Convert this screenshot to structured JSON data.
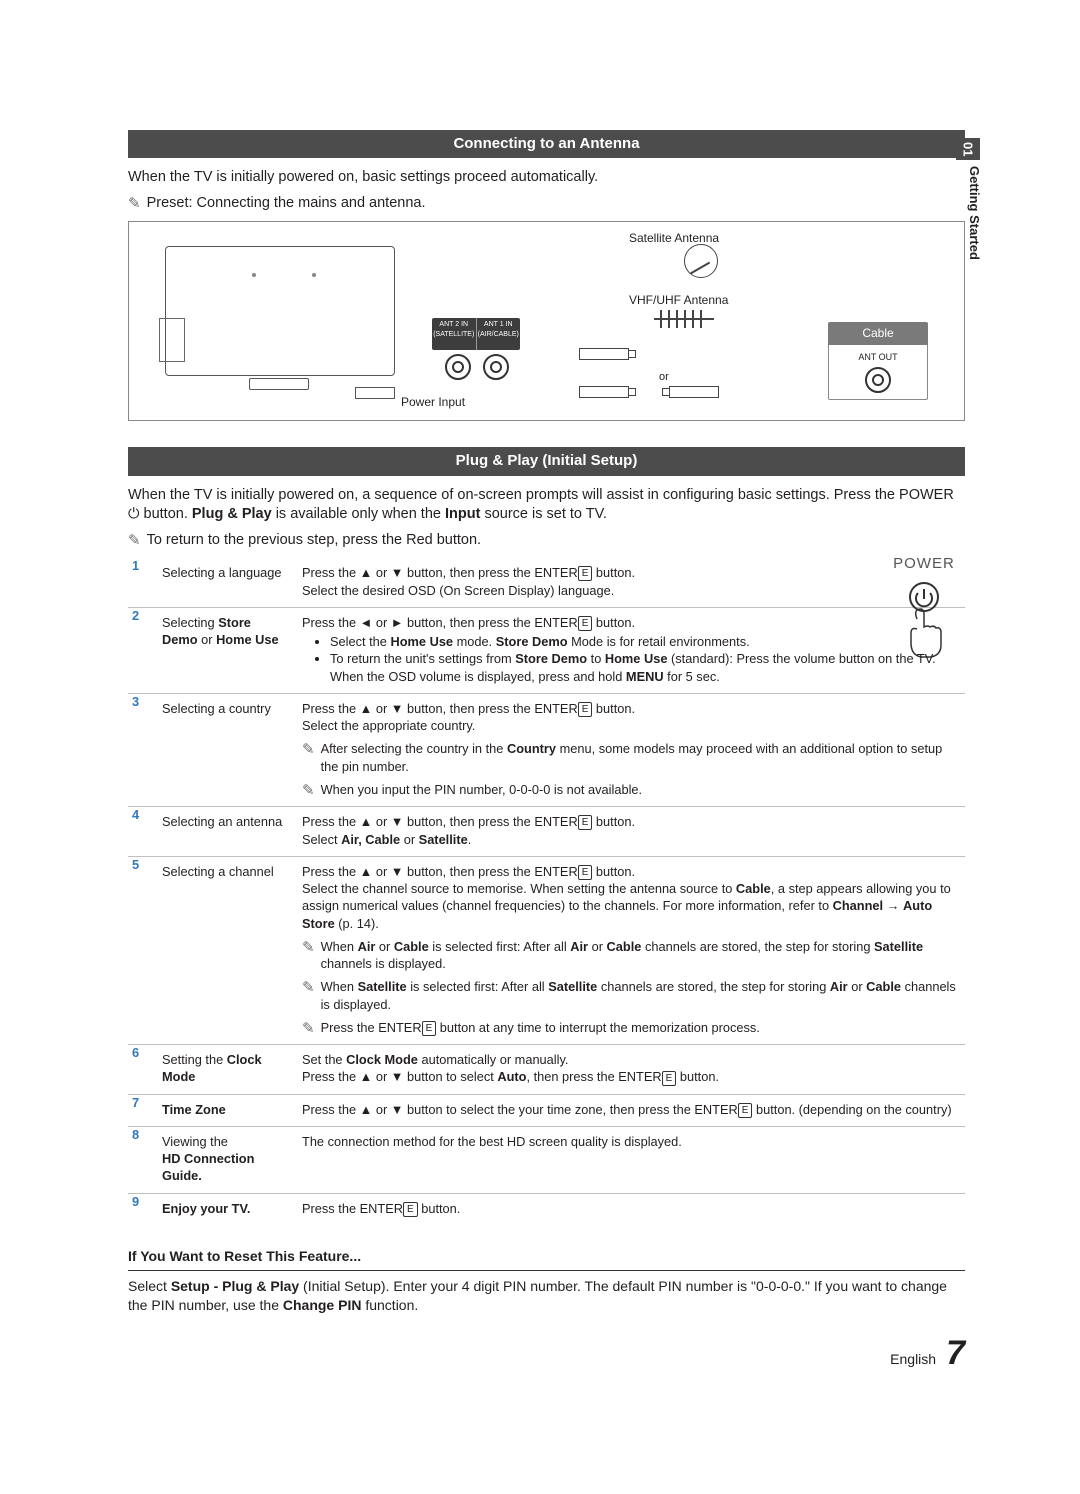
{
  "sidebar": {
    "num": "01",
    "label": "Getting Started"
  },
  "section1": {
    "title": "Connecting to an Antenna",
    "intro": "When the TV is initially powered on, basic settings proceed automatically.",
    "preset": "Preset: Connecting the mains and antenna.",
    "diagram": {
      "satellite": "Satellite Antenna",
      "vhf": "VHF/UHF Antenna",
      "or": "or",
      "power": "Power Input",
      "port1": "ANT 2 IN\n(SATELLITE)",
      "port2": "ANT 1 IN\n(AIR/CABLE)",
      "cable": "Cable",
      "antout": "ANT OUT"
    }
  },
  "section2": {
    "title": "Plug & Play (Initial Setup)",
    "intro_a": "When the TV is initially powered on, a sequence of on-screen prompts will assist in configuring basic settings. Press the POWER ",
    "intro_b": " button. ",
    "intro_bold": "Plug & Play",
    "intro_c": " is available only when the ",
    "intro_bold2": "Input",
    "intro_d": " source is set to TV.",
    "return_note": "To return to the previous step, press the Red button.",
    "power_label": "POWER"
  },
  "steps": [
    {
      "n": "1",
      "title": "Selecting a language",
      "body1a": "Press the ▲ or ▼ button, then press the ENTER",
      "body1b": " button.",
      "body2": "Select the desired OSD (On Screen Display) language."
    },
    {
      "n": "2",
      "title_a": "Selecting ",
      "title_bold": "Store Demo",
      "title_b": " or ",
      "title_bold2": "Home Use",
      "body1a": "Press the ◄ or ► button, then press the ENTER",
      "body1b": " button.",
      "bullet1_a": "Select the ",
      "bullet1_b": "Home Use",
      "bullet1_c": " mode. ",
      "bullet1_d": "Store Demo",
      "bullet1_e": " Mode is for retail environments.",
      "bullet2_a": "To return the unit's settings from ",
      "bullet2_b": "Store Demo",
      "bullet2_c": " to ",
      "bullet2_d": "Home Use",
      "bullet2_e": " (standard): Press the volume button on the TV. When the OSD volume is displayed, press and hold ",
      "bullet2_f": "MENU",
      "bullet2_g": " for 5 sec."
    },
    {
      "n": "3",
      "title": "Selecting a country",
      "body1a": "Press the ▲ or ▼ button, then press the ENTER",
      "body1b": " button.",
      "body2": "Select the appropriate country.",
      "note1_a": "After selecting the country in the ",
      "note1_b": "Country",
      "note1_c": " menu, some models may proceed with an additional option to setup the pin number.",
      "note2": "When you input the PIN number, 0-0-0-0 is not available."
    },
    {
      "n": "4",
      "title": "Selecting an antenna",
      "body1a": "Press the ▲ or ▼ button, then press the ENTER",
      "body1b": " button.",
      "body2_a": "Select ",
      "body2_b": "Air, Cable",
      "body2_c": " or ",
      "body2_d": "Satellite",
      "body2_e": "."
    },
    {
      "n": "5",
      "title": "Selecting a channel",
      "body1a": "Press the ▲ or ▼ button, then press the ENTER",
      "body1b": " button.",
      "body2_a": "Select the channel source to memorise. When setting the antenna source to ",
      "body2_b": "Cable",
      "body2_c": ", a step appears allowing you to assign numerical values (channel frequencies) to the channels. For more information, refer to ",
      "body2_d": "Channel",
      "body2_e": " → ",
      "body2_f": "Auto Store",
      "body2_g": " (p. 14).",
      "note1_a": "When ",
      "note1_b": "Air",
      "note1_c": " or ",
      "note1_d": "Cable",
      "note1_e": " is selected first: After all ",
      "note1_f": "Air",
      "note1_g": " or ",
      "note1_h": "Cable",
      "note1_i": " channels are stored, the step for storing ",
      "note1_j": "Satellite",
      "note1_k": " channels is displayed.",
      "note2_a": "When ",
      "note2_b": "Satellite",
      "note2_c": " is selected first: After all ",
      "note2_d": "Satellite",
      "note2_e": " channels are stored, the step for storing ",
      "note2_f": "Air",
      "note2_g": " or ",
      "note2_h": "Cable",
      "note2_i": " channels is displayed.",
      "note3_a": "Press the ENTER",
      "note3_b": " button at any time to interrupt the memorization process."
    },
    {
      "n": "6",
      "title_a": "Setting the ",
      "title_b": "Clock Mode",
      "body1_a": "Set the ",
      "body1_b": "Clock Mode",
      "body1_c": " automatically or manually.",
      "body2_a": "Press the ▲ or ▼ button to select ",
      "body2_b": "Auto",
      "body2_c": ", then press the ENTER",
      "body2_d": " button."
    },
    {
      "n": "7",
      "title": "Time Zone",
      "body_a": "Press the ▲ or ▼ button to select the your time zone, then press the ENTER",
      "body_b": " button. (depending on the country)"
    },
    {
      "n": "8",
      "title_a": "Viewing the ",
      "title_b": "HD Connection Guide.",
      "body": "The connection method for the best HD screen quality is displayed."
    },
    {
      "n": "9",
      "title": "Enjoy your TV.",
      "body_a": "Press the ENTER",
      "body_b": " button."
    }
  ],
  "reset": {
    "heading": "If You Want to Reset This Feature...",
    "body_a": "Select ",
    "body_b": "Setup - Plug & Play",
    "body_c": " (Initial Setup). Enter your 4 digit PIN number. The default PIN number is \"0-0-0-0.\" If you want to change the PIN number, use the ",
    "body_d": "Change PIN",
    "body_e": " function."
  },
  "footer": {
    "lang": "English",
    "page": "7"
  },
  "glyph": {
    "enter": "E"
  }
}
